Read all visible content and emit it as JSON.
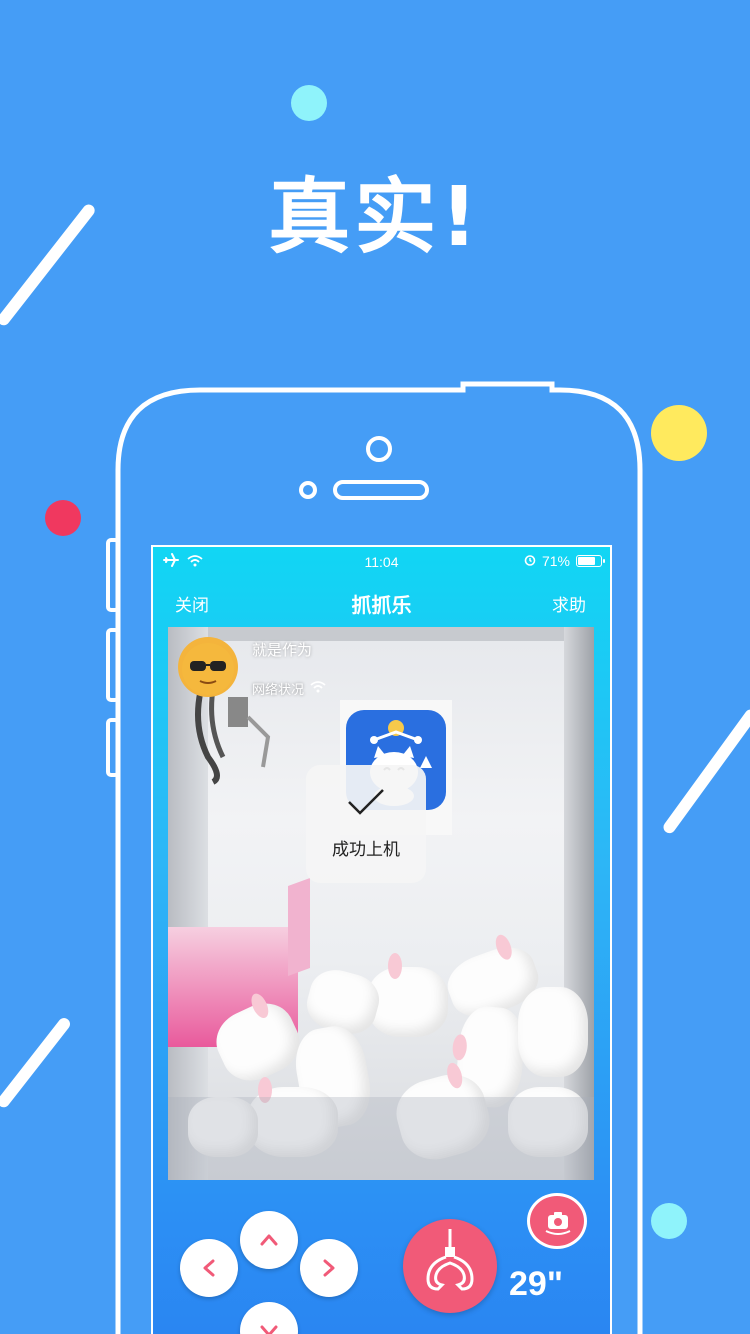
{
  "headline": "真实!",
  "colors": {
    "background": "#459df6",
    "accent_pink": "#f15a78",
    "dot_cyan": "#8ff3fb",
    "dot_yellow": "#ffea5e",
    "dot_red": "#f0385f"
  },
  "statusbar": {
    "time": "11:04",
    "battery": "71%",
    "icons": [
      "airplane-icon",
      "wifi-icon",
      "alarm-icon",
      "battery-icon"
    ]
  },
  "navbar": {
    "close_label": "关闭",
    "title": "抓抓乐",
    "help_label": "求助"
  },
  "live": {
    "player_name": "就是作为",
    "network_label": "网络状况"
  },
  "toast": {
    "message": "成功上机"
  },
  "controls": {
    "countdown": "29\"",
    "buttons": [
      "up-button",
      "down-button",
      "left-button",
      "right-button",
      "grab-button",
      "camera-switch-button"
    ]
  }
}
